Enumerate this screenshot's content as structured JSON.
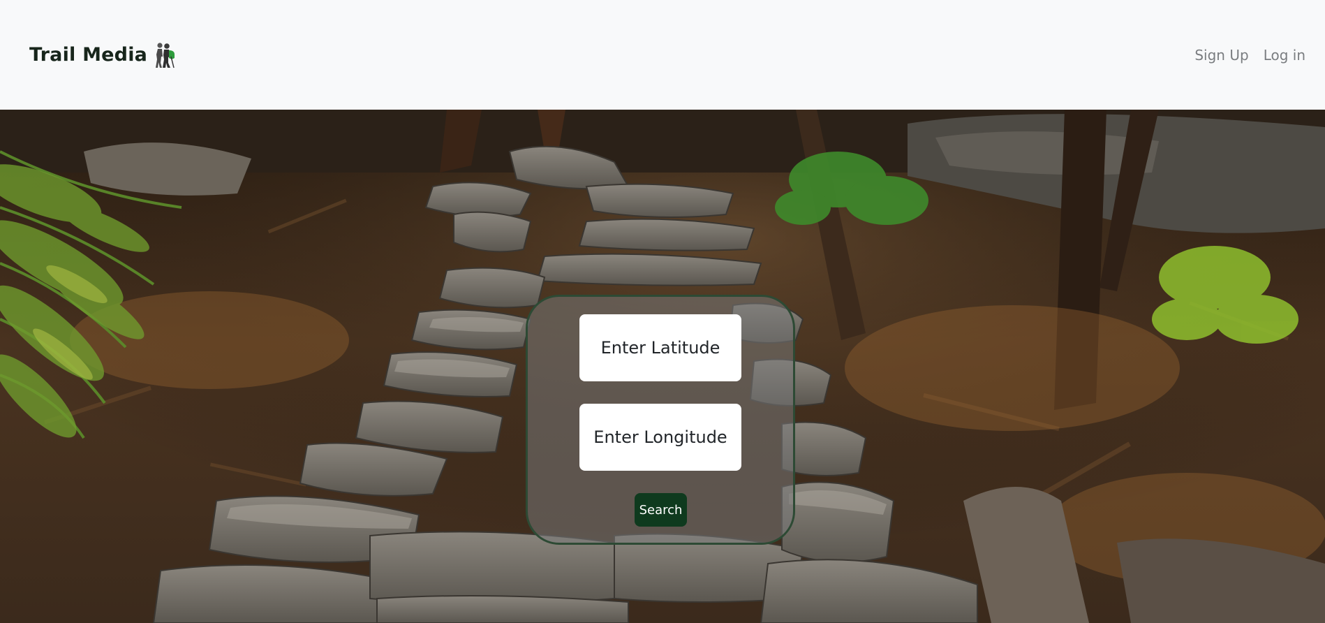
{
  "header": {
    "brand_text": "Trail Media",
    "brand_icon": "hikers-icon",
    "nav": {
      "signup_label": "Sign Up",
      "login_label": "Log in"
    }
  },
  "search": {
    "latitude_placeholder": "Enter Latitude",
    "longitude_placeholder": "Enter Longitude",
    "button_label": "Search"
  },
  "colors": {
    "brand_text": "#17251b",
    "nav_link": "#7a7d80",
    "header_bg": "#f8f9fa",
    "panel_border": "#2d4a34",
    "button_bg": "#0f3a1e"
  }
}
